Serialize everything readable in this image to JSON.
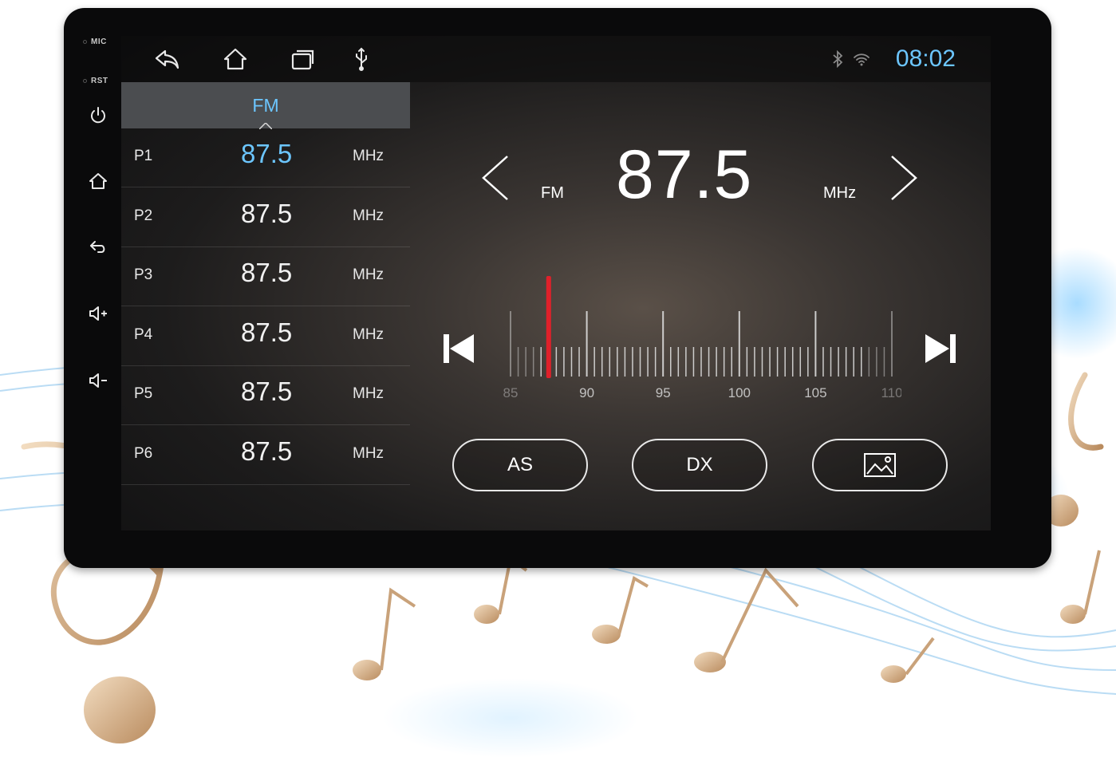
{
  "device": {
    "mic_label": "MIC",
    "rst_label": "RST"
  },
  "status": {
    "clock": "08:02"
  },
  "radio": {
    "band_tab": "FM",
    "presets": [
      {
        "label": "P1",
        "freq": "87.5",
        "unit": "MHz",
        "active": true
      },
      {
        "label": "P2",
        "freq": "87.5",
        "unit": "MHz",
        "active": false
      },
      {
        "label": "P3",
        "freq": "87.5",
        "unit": "MHz",
        "active": false
      },
      {
        "label": "P4",
        "freq": "87.5",
        "unit": "MHz",
        "active": false
      },
      {
        "label": "P5",
        "freq": "87.5",
        "unit": "MHz",
        "active": false
      },
      {
        "label": "P6",
        "freq": "87.5",
        "unit": "MHz",
        "active": false
      }
    ],
    "current": {
      "band": "FM",
      "freq": "87.5",
      "unit": "MHz"
    },
    "dial": {
      "min": 85,
      "max": 110,
      "current": 87.5,
      "labels": [
        "85",
        "90",
        "95",
        "100",
        "105",
        "110"
      ]
    },
    "buttons": {
      "as_label": "AS",
      "dx_label": "DX",
      "wallpaper_icon": "image-icon"
    }
  },
  "colors": {
    "accent": "#6cc6ff",
    "needle": "#e0202a"
  }
}
